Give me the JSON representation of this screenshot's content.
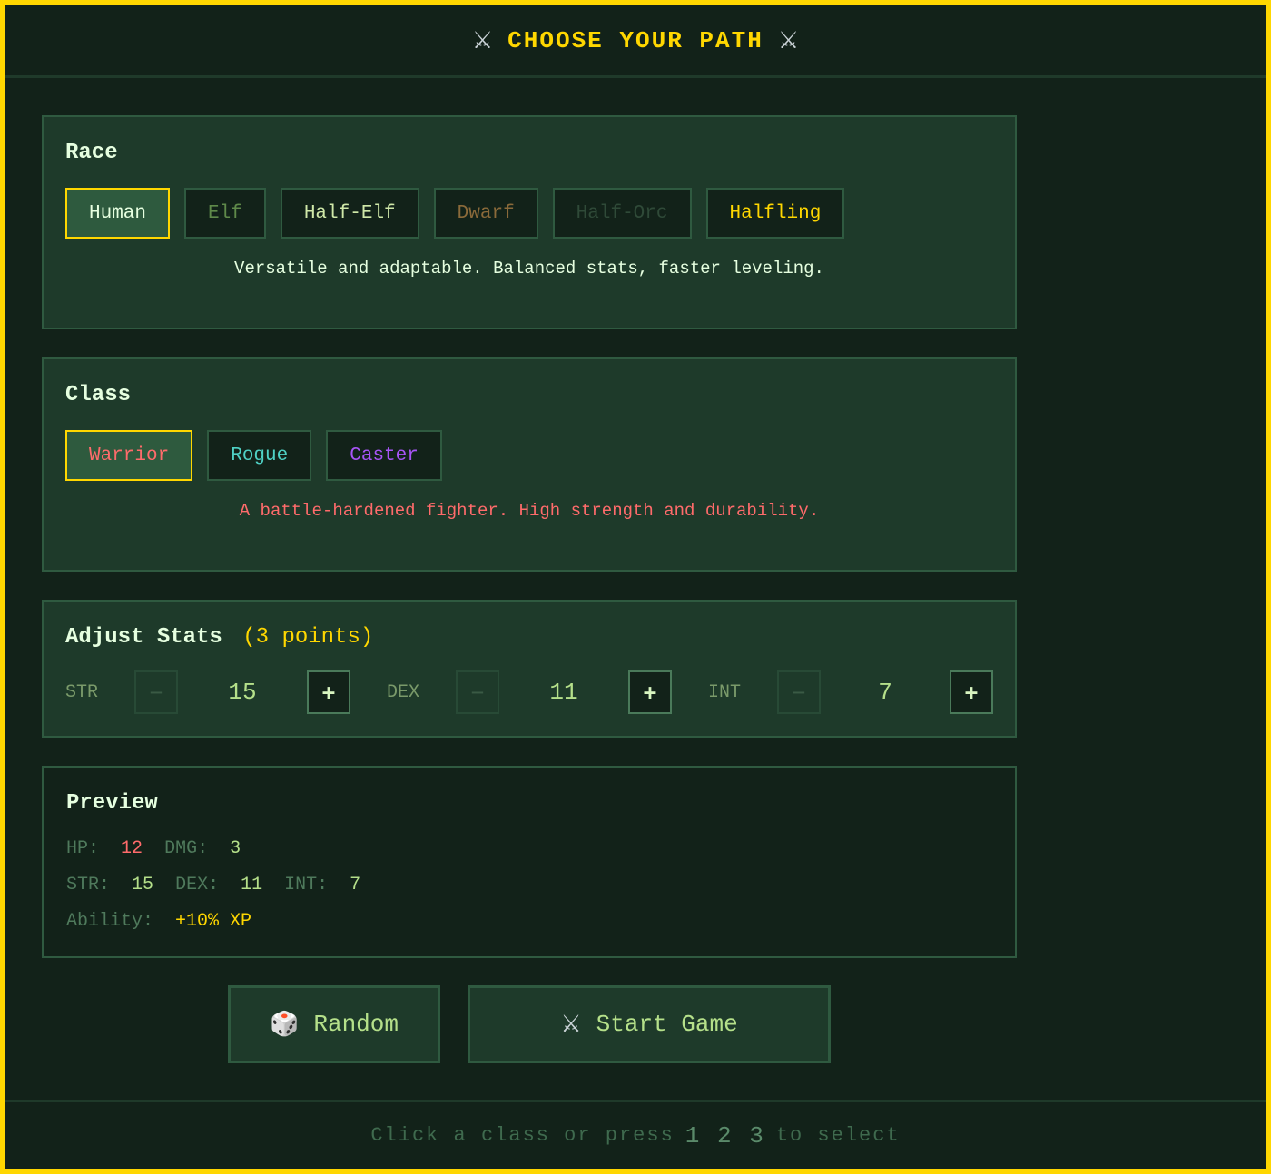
{
  "header": {
    "title": "CHOOSE YOUR PATH",
    "icon_left": "crossed-swords-icon",
    "icon_right": "crossed-swords-icon"
  },
  "race": {
    "heading": "Race",
    "options": [
      {
        "label": "Human",
        "color": "#e6ffe0",
        "selected": true
      },
      {
        "label": "Elf",
        "color": "#5f8a4a",
        "selected": false
      },
      {
        "label": "Half-Elf",
        "color": "#cfe8a8",
        "selected": false
      },
      {
        "label": "Dwarf",
        "color": "#8a6a3a",
        "selected": false
      },
      {
        "label": "Half-Orc",
        "color": "#2f4a38",
        "selected": false
      },
      {
        "label": "Halfling",
        "color": "#ffd700",
        "selected": false
      }
    ],
    "description": "Versatile and adaptable. Balanced stats, faster leveling.",
    "description_color": "#e6ffe0"
  },
  "class": {
    "heading": "Class",
    "options": [
      {
        "label": "Warrior",
        "color": "#ff6b6b",
        "selected": true
      },
      {
        "label": "Rogue",
        "color": "#4fd1c5",
        "selected": false
      },
      {
        "label": "Caster",
        "color": "#a855f7",
        "selected": false
      }
    ],
    "description": "A battle-hardened fighter. High strength and durability.",
    "description_color": "#ff6b6b"
  },
  "stats": {
    "heading": "Adjust Stats",
    "points": "(3 points)",
    "minus_label": "−",
    "plus_label": "+",
    "items": [
      {
        "label": "STR",
        "value": "15"
      },
      {
        "label": "DEX",
        "value": "11"
      },
      {
        "label": "INT",
        "value": "7"
      }
    ]
  },
  "preview": {
    "heading": "Preview",
    "hp_label": "HP:",
    "hp": "12",
    "dmg_label": "DMG:",
    "dmg": "3",
    "str_label": "STR:",
    "str": "15",
    "dex_label": "DEX:",
    "dex": "11",
    "int_label": "INT:",
    "int": "7",
    "ability_label": "Ability:",
    "ability": "+10% XP"
  },
  "buttons": {
    "random": {
      "label": "Random",
      "icon": "dice-icon"
    },
    "start": {
      "label": "Start Game",
      "icon": "crossed-swords-icon"
    }
  },
  "footer": {
    "prefix": "Click a class or press",
    "keys": "1 2 3",
    "suffix": "to select"
  }
}
